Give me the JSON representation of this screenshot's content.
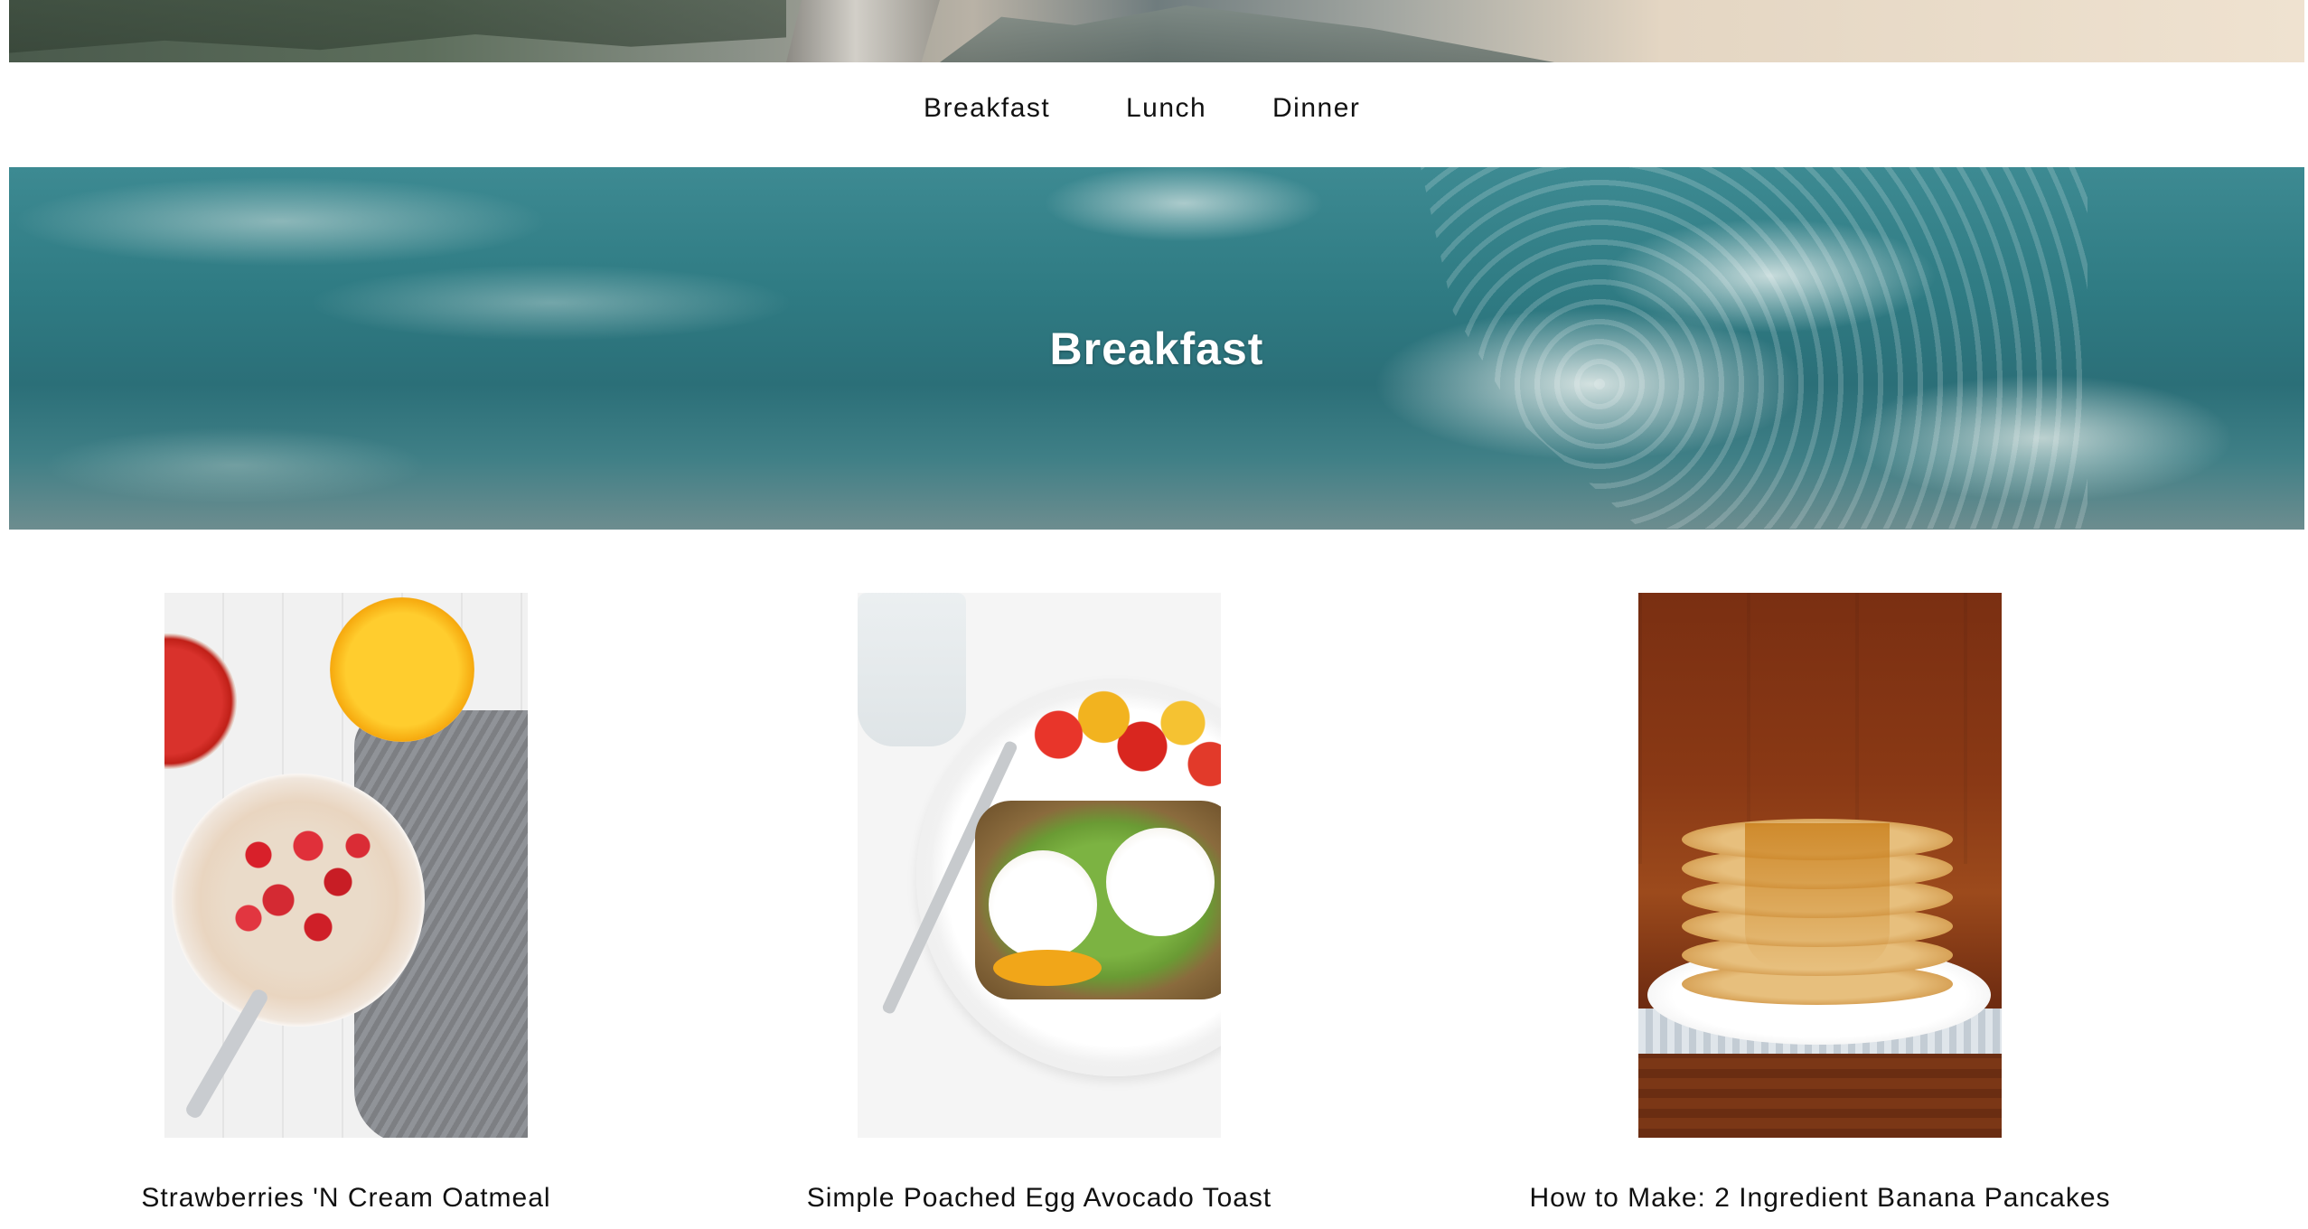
{
  "nav": {
    "items": [
      {
        "label": "Breakfast"
      },
      {
        "label": "Lunch"
      },
      {
        "label": "Dinner"
      }
    ]
  },
  "hero": {
    "title": "Breakfast"
  },
  "recipes": [
    {
      "title": "Strawberries 'N Cream Oatmeal",
      "image": "oatmeal-with-strawberries-photo"
    },
    {
      "title": "Simple Poached Egg Avocado Toast",
      "image": "poached-egg-avocado-toast-photo"
    },
    {
      "title": "How to Make: 2 Ingredient Banana Pancakes",
      "image": "banana-pancakes-stack-photo"
    }
  ]
}
